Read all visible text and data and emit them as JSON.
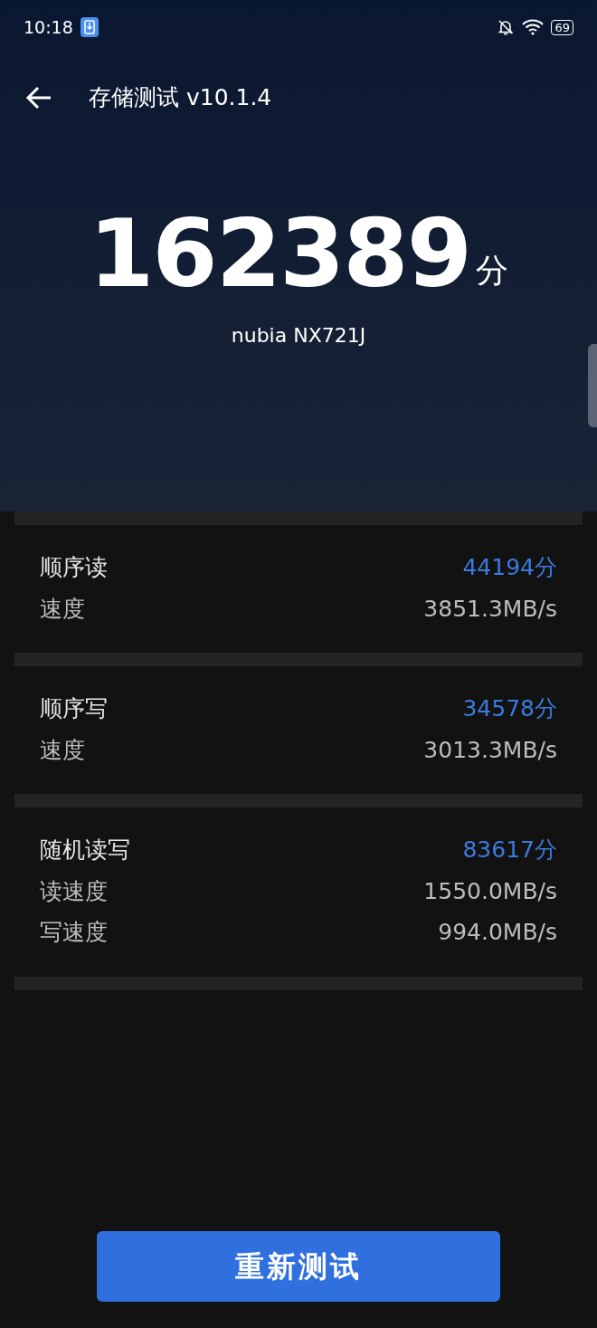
{
  "status_bar": {
    "time": "10:18",
    "battery": "69"
  },
  "header": {
    "title": "存储测试 v10.1.4"
  },
  "total": {
    "score": "162389",
    "unit": "分",
    "device": "nubia NX721J"
  },
  "results": [
    {
      "title": "顺序读",
      "score": "44194分",
      "metrics": [
        {
          "label": "速度",
          "value": "3851.3MB/s"
        }
      ]
    },
    {
      "title": "顺序写",
      "score": "34578分",
      "metrics": [
        {
          "label": "速度",
          "value": "3013.3MB/s"
        }
      ]
    },
    {
      "title": "随机读写",
      "score": "83617分",
      "metrics": [
        {
          "label": "读速度",
          "value": "1550.0MB/s"
        },
        {
          "label": "写速度",
          "value": "994.0MB/s"
        }
      ]
    }
  ],
  "button": {
    "label": "重新测试"
  }
}
